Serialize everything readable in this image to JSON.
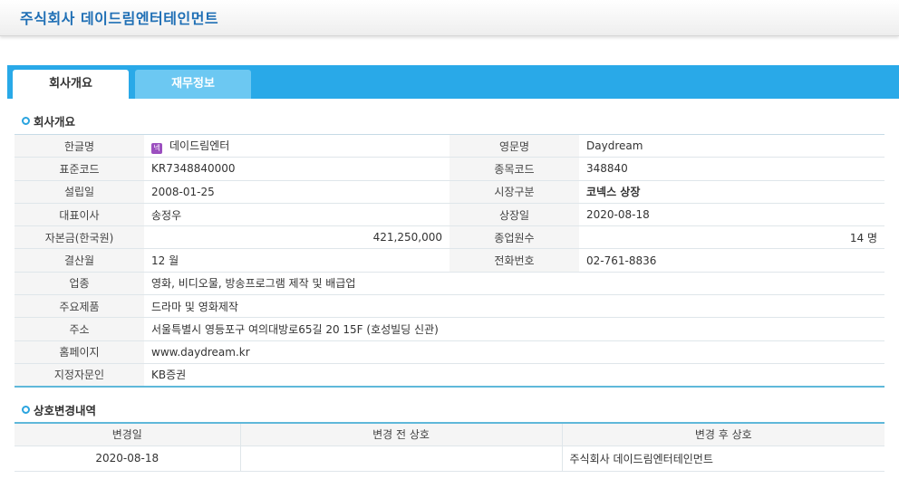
{
  "header": {
    "title": "주식회사 데이드림엔터테인먼트"
  },
  "tabs": [
    {
      "label": "회사개요",
      "active": true
    },
    {
      "label": "재무정보",
      "active": false
    }
  ],
  "overview": {
    "section_title": "회사개요",
    "korean_name_label": "한글명",
    "korean_name_badge": "넥",
    "korean_name": "데이드림엔터",
    "english_name_label": "영문명",
    "english_name": "Daydream",
    "std_code_label": "표준코드",
    "std_code": "KR7348840000",
    "ticker_label": "종목코드",
    "ticker": "348840",
    "founded_label": "설립일",
    "founded": "2008-01-25",
    "market_label": "시장구분",
    "market": "코넥스 상장",
    "ceo_label": "대표이사",
    "ceo": "송정우",
    "listed_label": "상장일",
    "listed": "2020-08-18",
    "capital_label": "자본금(한국원)",
    "capital": "421,250,000",
    "employees_label": "종업원수",
    "employees": "14  명",
    "fiscal_label": "결산월",
    "fiscal": "12  월",
    "phone_label": "전화번호",
    "phone": "02-761-8836",
    "industry_label": "업종",
    "industry": "영화, 비디오물, 방송프로그램 제작 및 배급업",
    "products_label": "주요제품",
    "products": "드라마 및 영화제작",
    "address_label": "주소",
    "address": "서울특별시 영등포구 여의대방로65길 20 15F (호성빌딩 신관)",
    "homepage_label": "홈페이지",
    "homepage": "www.daydream.kr",
    "advisor_label": "지정자문인",
    "advisor": "KB증권"
  },
  "name_history": {
    "section_title": "상호변경내역",
    "columns": [
      "변경일",
      "변경 전 상호",
      "변경 후 상호"
    ],
    "rows": [
      {
        "date": "2020-08-18",
        "before": "",
        "after": "주식회사 데이드림엔터테인먼트"
      }
    ]
  },
  "colors": {
    "accent": "#29a9e8",
    "title": "#1f6fb5",
    "market": "#e87d12"
  }
}
